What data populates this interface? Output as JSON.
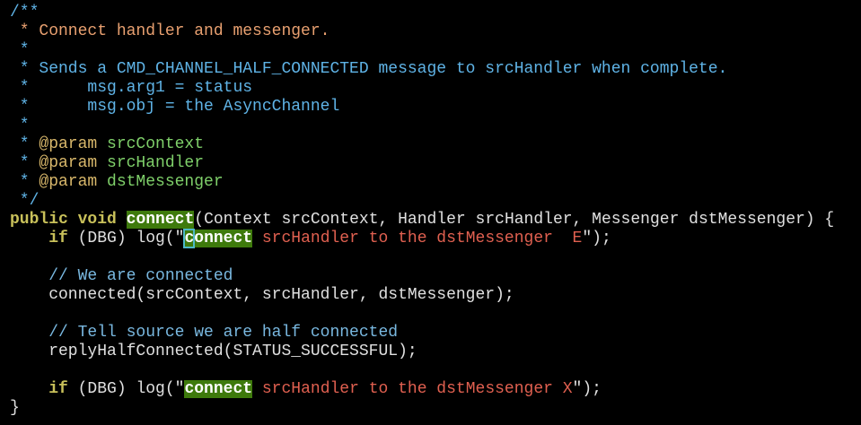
{
  "code": {
    "l1": "/**",
    "l2": " * Connect handler and messenger.",
    "l3": " *",
    "l4": " * Sends a CMD_CHANNEL_HALF_CONNECTED message to srcHandler when complete.",
    "l5": " *      msg.arg1 = status",
    "l6": " *      msg.obj = the AsyncChannel",
    "l7": " *",
    "l8_prefix": " * ",
    "l8_tag": "@param",
    "l8_name": " srcContext",
    "l9_prefix": " * ",
    "l9_tag": "@param",
    "l9_name": " srcHandler",
    "l10_prefix": " * ",
    "l10_tag": "@param",
    "l10_name": " dstMessenger",
    "l11": " */",
    "l12_kw1": "public",
    "l12_kw2": "void",
    "l12_fn": "connect",
    "l12_rest": "(Context srcContext, Handler srcHandler, Messenger dstMessenger) {",
    "l13_indent": "    ",
    "l13_kw": "if",
    "l13_mid": " (DBG) log(\"",
    "l13_hl_first": "c",
    "l13_hl_rest": "onnect",
    "l13_str": " srcHandler to the dstMessenger  E",
    "l13_end": "\");",
    "l14": "",
    "l15": "    // We are connected",
    "l16": "    connected(srcContext, srcHandler, dstMessenger);",
    "l17": "",
    "l18": "    // Tell source we are half connected",
    "l19": "    replyHalfConnected(STATUS_SUCCESSFUL);",
    "l20": "",
    "l21_indent": "    ",
    "l21_kw": "if",
    "l21_mid": " (DBG) log(\"",
    "l21_hl": "connect",
    "l21_str": " srcHandler to the dstMessenger X",
    "l21_end": "\");",
    "l22": "}"
  }
}
